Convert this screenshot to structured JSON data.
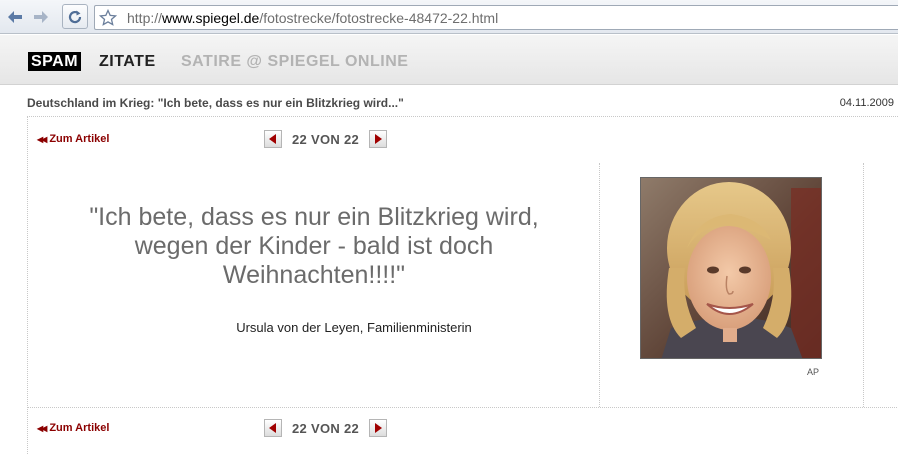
{
  "browser": {
    "url_scheme": "http://",
    "url_host": "www.spiegel.de",
    "url_path": "/fotostrecke/fotostrecke-48472-22.html"
  },
  "header": {
    "logo": "SPAM",
    "section": "ZITATE",
    "tagline": "SATIRE @ SPIEGEL ONLINE"
  },
  "article": {
    "title": "Deutschland im Krieg: \"Ich bete, dass es nur ein Blitzkrieg wird...\"",
    "date": "04.11.2009"
  },
  "nav": {
    "back_label": "Zum Artikel",
    "counter": "22 VON 22"
  },
  "quote": {
    "text": "\"Ich bete, dass es nur ein Blitzkrieg wird, wegen der Kinder - bald ist doch Weihnachten!!!!\"",
    "author": "Ursula von der Leyen, Familienministerin"
  },
  "photo": {
    "credit": "AP"
  },
  "colors": {
    "accent_red": "#8b0000",
    "quote_gray": "#6b6b6b"
  }
}
